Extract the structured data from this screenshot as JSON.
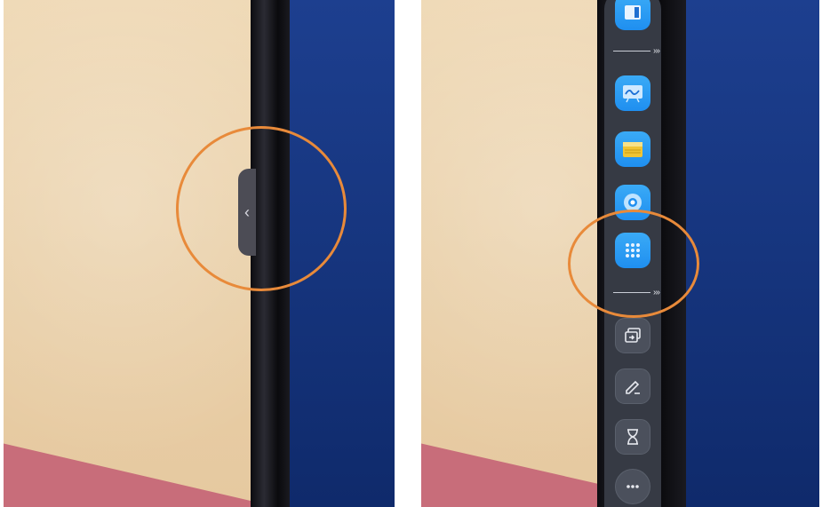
{
  "left_photo": {
    "edge_handle": {
      "icon": "chevron-left-icon",
      "glyph": "‹"
    },
    "highlight_color": "#e88a3a"
  },
  "right_photo": {
    "toolbar": {
      "divider_1_label": "›››",
      "divider_2_label": "›››",
      "icons": [
        "window-icon",
        "whiteboard-icon",
        "folder-icon",
        "browser-icon",
        "apps-grid-icon",
        "screen-share-icon",
        "pen-icon",
        "timer-icon",
        "more-icon"
      ]
    },
    "highlight_color": "#e88a3a"
  }
}
